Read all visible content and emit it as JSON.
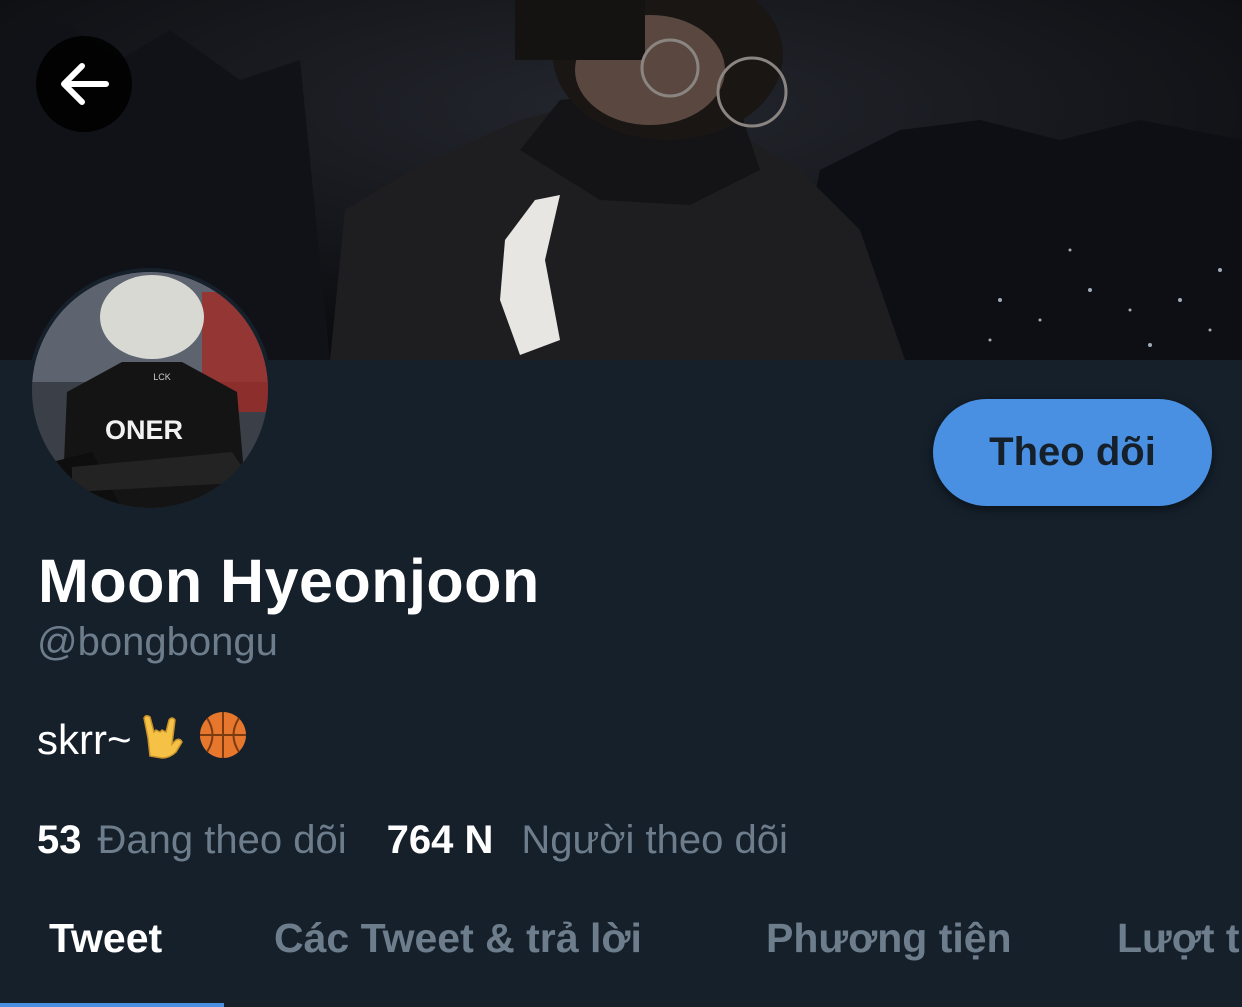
{
  "profile": {
    "display_name": "Moon Hyeonjoon",
    "handle": "@bongbongu",
    "bio_text": "skrr~",
    "bio_emojis": [
      "sign-of-the-horns-emoji",
      "basketball-emoji"
    ],
    "avatar_jersey_text": "ONER"
  },
  "actions": {
    "follow_label": "Theo dõi",
    "back_icon": "arrow-left-icon"
  },
  "stats": {
    "following_count": "53",
    "following_label": "Đang theo dõi",
    "followers_count": "764 N",
    "followers_label": "Người theo dõi"
  },
  "tabs": [
    {
      "label": "Tweet",
      "active": true
    },
    {
      "label": "Các Tweet & trả lời",
      "active": false
    },
    {
      "label": "Phương tiện",
      "active": false
    },
    {
      "label": "Lượt t",
      "active": false
    }
  ],
  "colors": {
    "background": "#15202b",
    "accent": "#4a90e2",
    "primary_text": "#ffffff",
    "secondary_text": "#6e7d8c"
  }
}
